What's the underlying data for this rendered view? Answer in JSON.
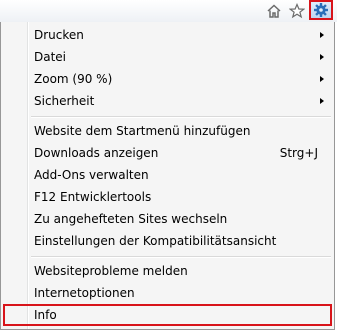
{
  "toolbar": {
    "icons": [
      "home-icon",
      "star-icon",
      "gear-icon"
    ]
  },
  "menu": {
    "items": [
      {
        "label": "Drucken",
        "submenu": true
      },
      {
        "label": "Datei",
        "submenu": true
      },
      {
        "label": "Zoom (90 %)",
        "submenu": true
      },
      {
        "label": "Sicherheit",
        "submenu": true
      },
      {
        "label": "Website dem Startmenü hinzufügen"
      },
      {
        "label": "Downloads anzeigen",
        "shortcut": "Strg+J"
      },
      {
        "label": "Add-Ons verwalten"
      },
      {
        "label": "F12 Entwicklertools"
      },
      {
        "label": "Zu angehefteten Sites wechseln"
      },
      {
        "label": "Einstellungen der Kompatibilitätsansicht"
      },
      {
        "label": "Websiteprobleme melden"
      },
      {
        "label": "Internetoptionen"
      },
      {
        "label": "Info"
      }
    ]
  },
  "colors": {
    "highlight_border": "#d8141a",
    "menu_background": "#f5f5f5",
    "gear_icon": "#2a6fb8"
  }
}
